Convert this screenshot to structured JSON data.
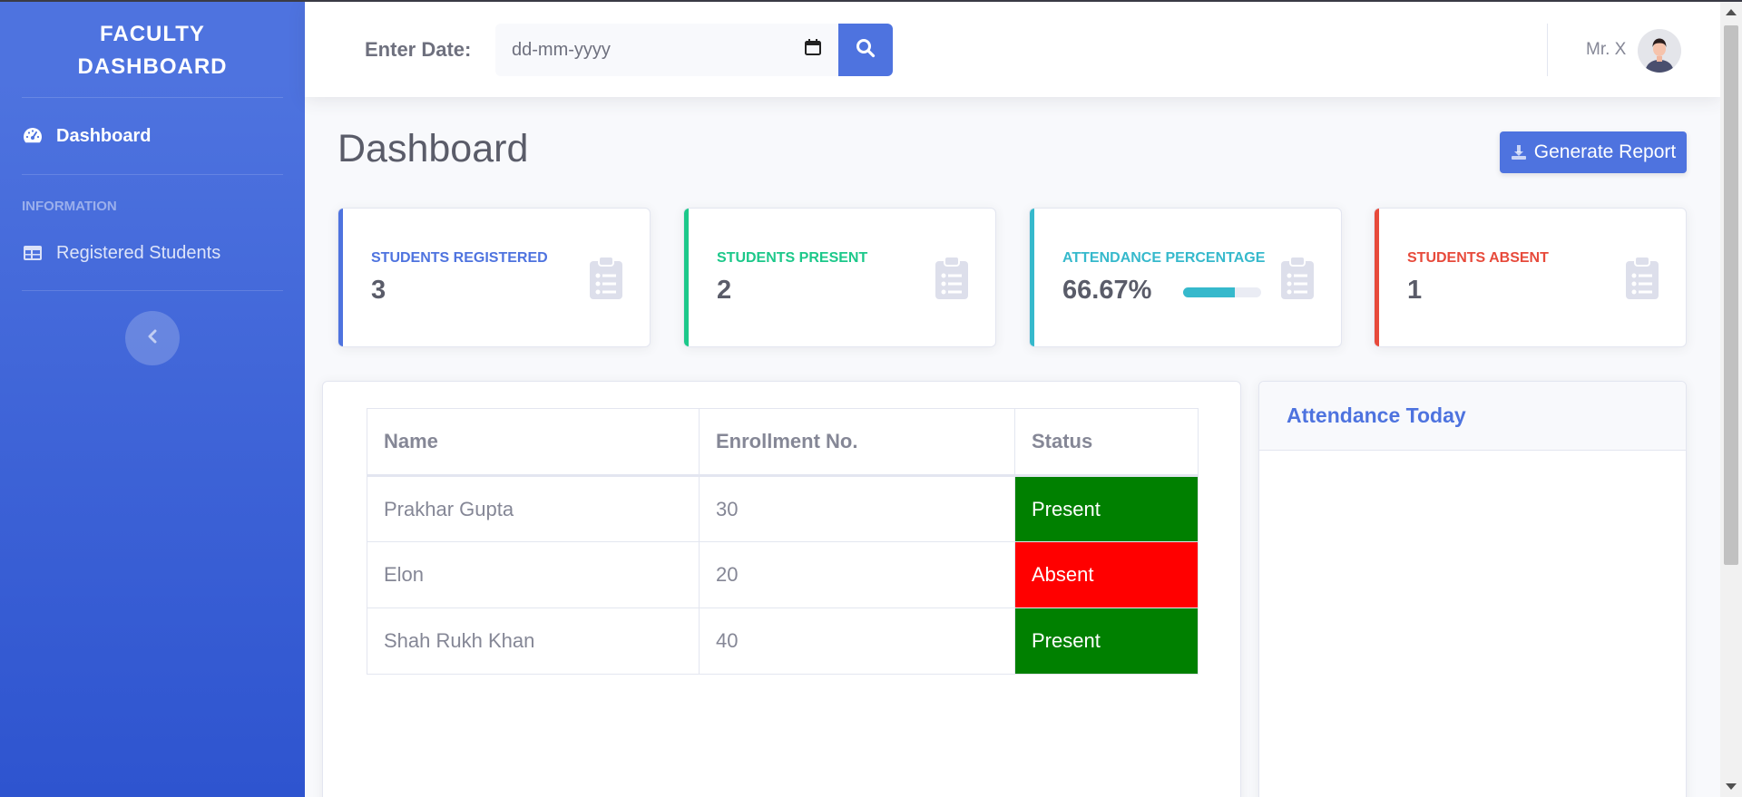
{
  "sidebar": {
    "brand_line1": "FACULTY",
    "brand_line2": "DASHBOARD",
    "items": [
      {
        "label": "Dashboard",
        "icon": "tachometer-icon"
      },
      {
        "label": "Registered Students",
        "icon": "table-icon"
      }
    ],
    "heading": "INFORMATION",
    "toggle_icon": "chevron-left-icon"
  },
  "topbar": {
    "date_label": "Enter Date:",
    "date_placeholder": "dd-mm-yyyy",
    "search_icon": "search-icon",
    "user_name": "Mr. X"
  },
  "main": {
    "title": "Dashboard",
    "report_button": "Generate Report"
  },
  "stats": [
    {
      "label": "STUDENTS REGISTERED",
      "value": "3",
      "color": "#4e73df"
    },
    {
      "label": "STUDENTS PRESENT",
      "value": "2",
      "color": "#1cc88a"
    },
    {
      "label": "ATTENDANCE PERCENTAGE",
      "value": "66.67%",
      "color": "#36b9cc",
      "progress_percent": 66.67
    },
    {
      "label": "STUDENTS ABSENT",
      "value": "1",
      "color": "#e74a3b"
    }
  ],
  "table": {
    "headers": [
      "Name",
      "Enrollment No.",
      "Status"
    ],
    "rows": [
      {
        "name": "Prakhar Gupta",
        "enrollment": "30",
        "status": "Present"
      },
      {
        "name": "Elon",
        "enrollment": "20",
        "status": "Absent"
      },
      {
        "name": "Shah Rukh Khan",
        "enrollment": "40",
        "status": "Present"
      }
    ],
    "status_colors": {
      "Present": "#008000",
      "Absent": "#ff0000"
    }
  },
  "attendance_panel": {
    "title": "Attendance Today"
  }
}
